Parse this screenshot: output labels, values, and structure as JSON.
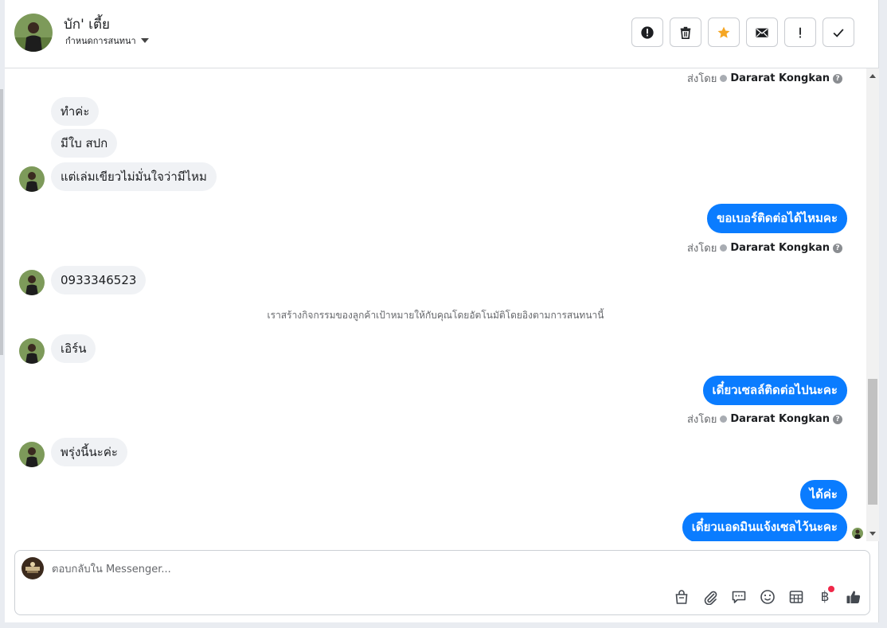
{
  "header": {
    "contact_name": "บัก' เตี้ย",
    "assign_label": "กำหนดการสนทนา"
  },
  "actions": [
    {
      "name": "spam-icon",
      "title": "spam"
    },
    {
      "name": "trash-icon",
      "title": "delete"
    },
    {
      "name": "star-icon",
      "title": "star"
    },
    {
      "name": "mail-icon",
      "title": "mark unread"
    },
    {
      "name": "exclamation-icon",
      "title": "follow up"
    },
    {
      "name": "check-icon",
      "title": "done"
    }
  ],
  "colors": {
    "outgoing_bubble": "#0a7cff",
    "incoming_bubble": "#f0f2f5",
    "star": "#f5a623",
    "notification_dot": "#f02849"
  },
  "thread": {
    "sent_by_prefix": "ส่งโดย",
    "agent_name": "Dararat Kongkan",
    "messages": {
      "m1": "ทำค่ะ",
      "m2": "มีใบ สปก",
      "m3": "แต่เล่มเขียวไม่มั่นใจว่ามีไหม",
      "m4": "ขอเบอร์ติดต่อได้ไหมคะ",
      "m5": "0933346523",
      "m6": "เอิร์น",
      "m7": "เดี๋ยวเซลล์ติดต่อไปนะคะ",
      "m8": "พรุ่งนี้นะค่ะ",
      "m9": "ได้ค่ะ",
      "m10": "เดี๋ยวแอดมินแจ้งเซลไว้นะคะ"
    },
    "system_note": "เราสร้างกิจกรรมของลูกค้าเป้าหมายให้กับคุณโดยอัตโนมัติโดยอิงตามการสนทนานี้"
  },
  "composer": {
    "placeholder": "ตอบกลับใน Messenger...",
    "value": "",
    "currency_symbol": "฿",
    "tools": [
      "shopping-bag-icon",
      "attachment-icon",
      "saved-reply-icon",
      "emoji-icon",
      "table-icon",
      "baht-icon",
      "like-icon"
    ]
  }
}
